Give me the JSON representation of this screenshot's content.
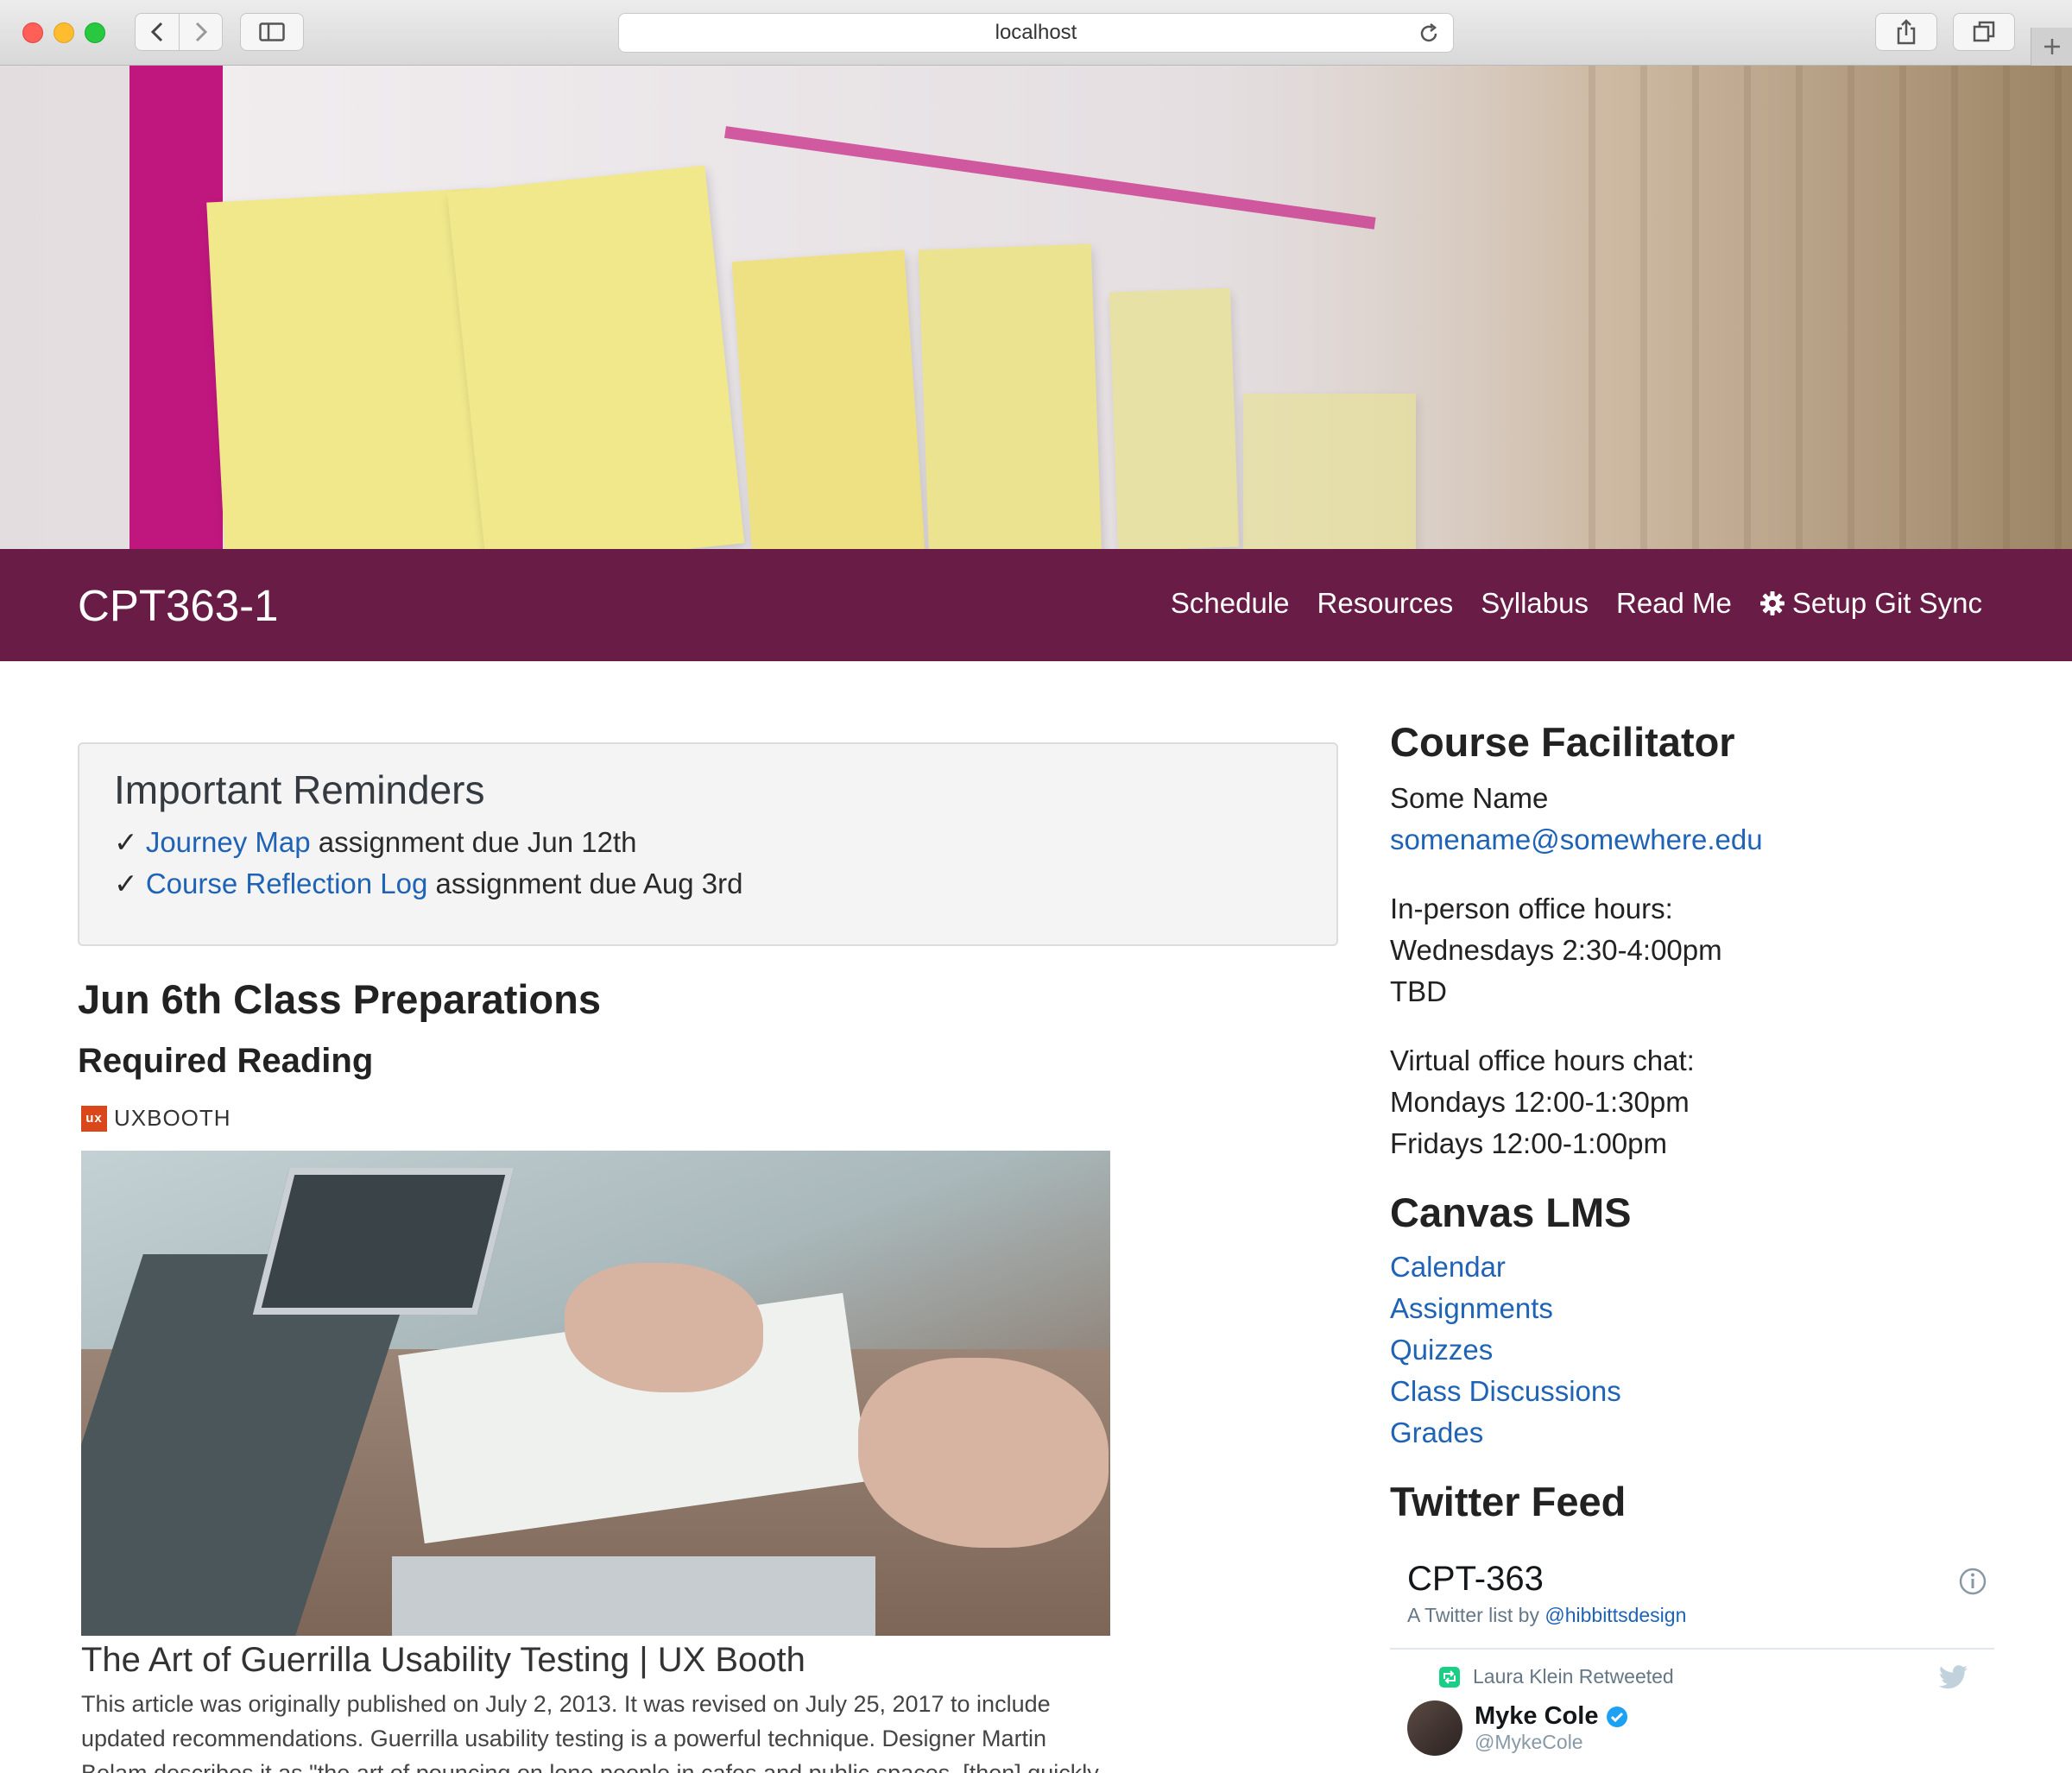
{
  "browser": {
    "url": "localhost"
  },
  "hero": {
    "image": "sticky-notes-customer-segments-photo"
  },
  "navbar": {
    "brand": "CPT363-1",
    "links": [
      {
        "label": "Schedule"
      },
      {
        "label": "Resources"
      },
      {
        "label": "Syllabus"
      },
      {
        "label": "Read Me"
      },
      {
        "label": "Setup Git Sync",
        "icon": "gear-icon"
      }
    ]
  },
  "reminders": {
    "title": "Important Reminders",
    "check": "✓",
    "items": [
      {
        "link": "Journey Map",
        "text": " assignment due Jun 12th"
      },
      {
        "link": "Course Reflection Log",
        "text": " assignment due Aug 3rd"
      }
    ]
  },
  "preparation": {
    "title": "Jun 6th Class Preparations",
    "subtitle": "Required Reading",
    "source": "UXBOOTH",
    "source_logo": "ux",
    "article_title": "The Art of Guerrilla Usability Testing | UX Booth",
    "article_desc": "This article was originally published on July 2, 2013. It was revised on July 25, 2017 to include updated recommendations. Guerrilla usability testing is a powerful technique. Designer Martin Belam describes it as \"the art of pouncing on lone people in cafes and public spaces, [then] quickly filming"
  },
  "sidebar": {
    "facilitator": {
      "title": "Course Facilitator",
      "name": "Some Name",
      "email": "somename@somewhere.edu",
      "inperson_label": "In-person office hours:",
      "inperson_time": "Wednesdays 2:30-4:00pm",
      "inperson_place": "TBD",
      "virtual_label": "Virtual office hours chat:",
      "virtual_mon": "Mondays 12:00-1:30pm",
      "virtual_fri": "Fridays 12:00-1:00pm"
    },
    "canvas": {
      "title": "Canvas LMS",
      "links": [
        "Calendar",
        "Assignments",
        "Quizzes",
        "Class Discussions",
        "Grades"
      ]
    },
    "twitter": {
      "title": "Twitter Feed",
      "list_name": "CPT-363",
      "list_by": "A Twitter list by ",
      "list_owner": "@hibbittsdesign",
      "retweet_text": "Laura Klein Retweeted",
      "author_name": "Myke Cole",
      "author_handle": "@MykeCole"
    }
  },
  "colors": {
    "navbar": "#681c46",
    "link": "#1f63b6"
  }
}
